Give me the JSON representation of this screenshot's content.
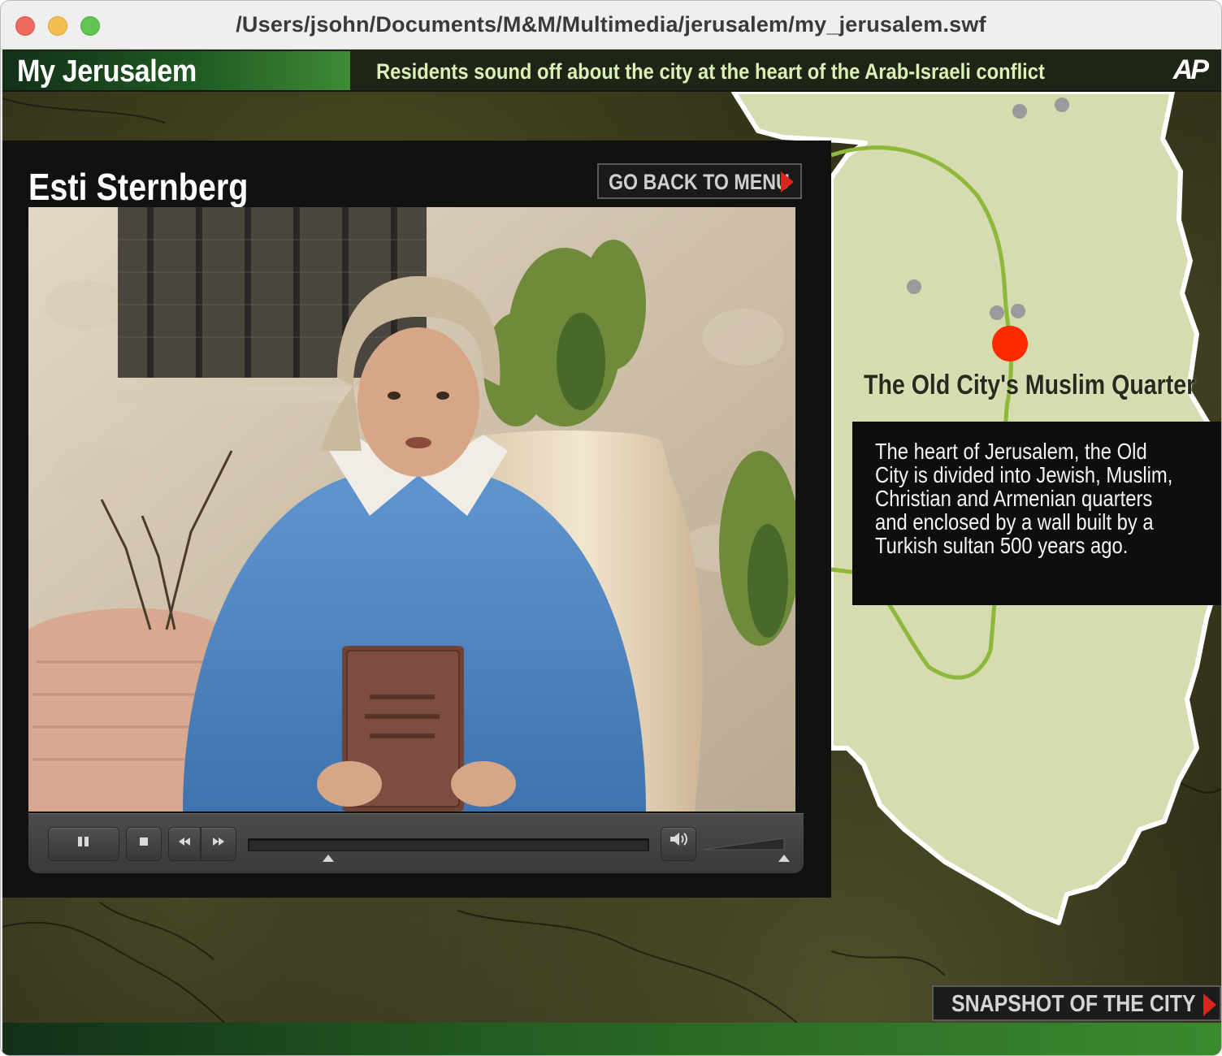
{
  "window": {
    "title": "/Users/jsohn/Documents/M&M/Multimedia/jerusalem/my_jerusalem.swf"
  },
  "header": {
    "brand": "My Jerusalem",
    "tagline": "Residents sound off about the city at the heart of the Arab-Israeli conflict",
    "logo": "AP"
  },
  "video_panel": {
    "person_name": "Esti Sternberg",
    "back_button_label": "GO BACK TO MENU",
    "playback": {
      "progress_fraction": 0.2,
      "volume_fraction": 1.0
    }
  },
  "controls": {
    "pause_icon": "pause-icon",
    "stop_icon": "stop-icon",
    "rewind_icon": "rewind-icon",
    "forward_icon": "fast-forward-icon",
    "volume_icon": "speaker-icon"
  },
  "location": {
    "title": "The Old City's Muslim Quarter",
    "description": "The heart of Jerusalem, the Old City is divided into Jewish, Muslim, Christian and Armenian quarters and enclosed by a wall built by a Turkish sultan 500 years ago."
  },
  "footer": {
    "snapshot_button_label": "SNAPSHOT OF THE CITY"
  },
  "colors": {
    "accent_green": "#3f8a36",
    "marker_red": "#ff2a00",
    "map_land": "#d6dbb0",
    "route_green": "#8db83a",
    "arrow_red": "#d8261c"
  }
}
